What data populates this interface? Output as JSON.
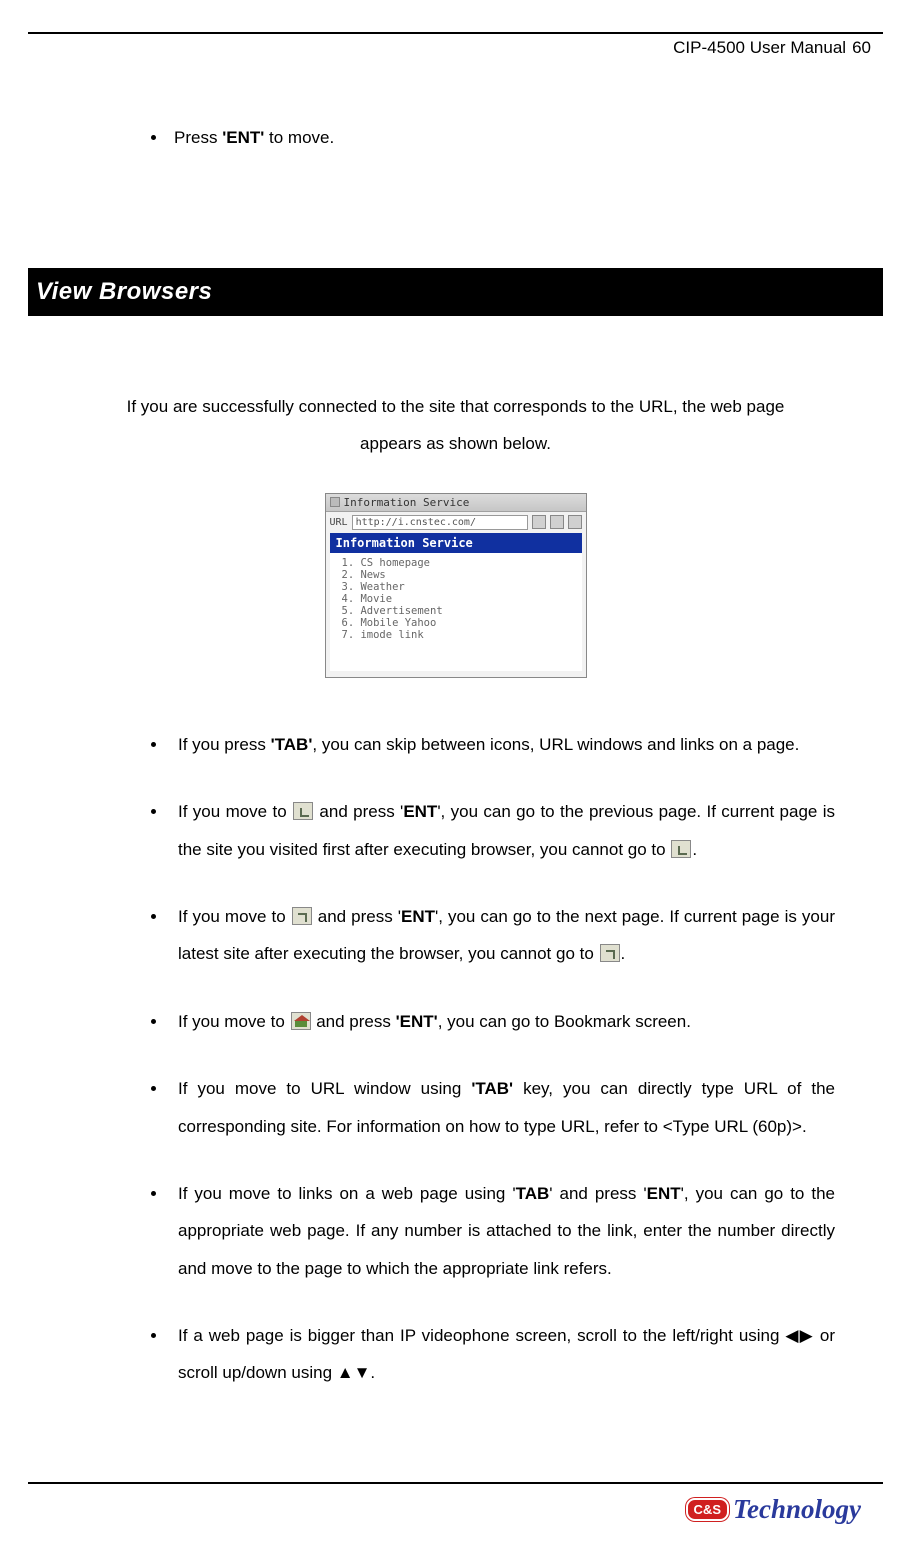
{
  "header": {
    "title": "CIP-4500 User Manual",
    "page_number": "60"
  },
  "top_bullet": {
    "pre": "Press ",
    "bold": "'ENT'",
    "post": " to move."
  },
  "section_title": "View Browsers",
  "intro_text": "If you are successfully connected to the site that corresponds to the URL, the web page appears as shown below.",
  "figure": {
    "titlebar": "Information Service",
    "url_label": "URL",
    "url_value": "http://i.cnstec.com/",
    "heading": "Information Service",
    "items": [
      "1. CS homepage",
      "2. News",
      "3. Weather",
      "4. Movie",
      "5. Advertisement",
      "6. Mobile Yahoo",
      "7. imode link"
    ]
  },
  "bullets": {
    "b1": {
      "pre": "If you press ",
      "bold": "'TAB'",
      "post": ", you can skip between icons, URL windows and links on a page."
    },
    "b2": {
      "s1": "If you move to ",
      "s2": " and press '",
      "bold": "ENT",
      "s3": "', you can go to the previous page. If current page is the site you visited first after executing browser, you cannot go to ",
      "s4": "."
    },
    "b3": {
      "s1": "If you move to ",
      "s2": " and press '",
      "bold": "ENT",
      "s3": "', you can go to the next page. If current page is your latest site after executing the browser, you cannot go to ",
      "s4": "."
    },
    "b4": {
      "s1": "If you move to ",
      "s2": " and press ",
      "bold": "'ENT'",
      "s3": ", you can go to Bookmark screen."
    },
    "b5": {
      "s1": "If you move to URL window using ",
      "bold": "'TAB'",
      "s2": " key, you can directly type URL of the corresponding site. For information on how to type URL, refer to <Type URL (60p)>."
    },
    "b6": {
      "s1": "If you move to links on a web page using '",
      "bold1": "TAB",
      "s2": "' and press '",
      "bold2": "ENT",
      "s3": "', you can go to the appropriate web page. If any number is attached to the link, enter the number directly and move to the page to which the appropriate link refers."
    },
    "b7": {
      "s1": "If a web page is bigger than IP videophone screen, scroll to the left/right using ",
      "arrows_lr": "◀▶",
      "s2": " or scroll up/down using ",
      "arrows_ud": "▲▼",
      "s3": "."
    }
  },
  "footer": {
    "logo_badge": "C&S",
    "logo_text": "Technology"
  }
}
